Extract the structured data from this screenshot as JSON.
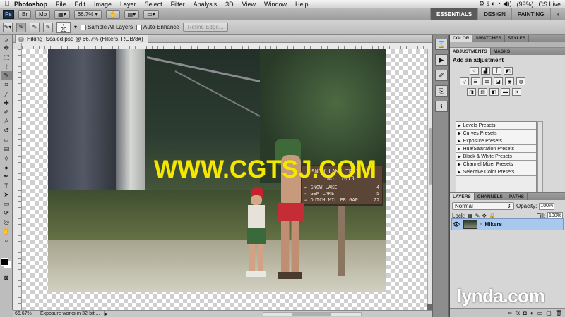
{
  "menubar": {
    "app": "Photoshop",
    "items": [
      "File",
      "Edit",
      "Image",
      "Layer",
      "Select",
      "Filter",
      "Analysis",
      "3D",
      "View",
      "Window",
      "Help"
    ],
    "battery": "(99%)",
    "cslive": "CS Live"
  },
  "appbar": {
    "ps": "Ps",
    "zoom": "66.7%",
    "workspaces": [
      "ESSENTIALS",
      "DESIGN",
      "PAINTING",
      "»"
    ]
  },
  "options": {
    "brush_size": "20",
    "sample_all": "Sample All Layers",
    "auto_enhance": "Auto-Enhance",
    "refine_edge": "Refine Edge..."
  },
  "document": {
    "tab_title": "Hiking_Scaled.psd @ 66.7% (Hikers, RGB/8#)",
    "sign": {
      "line1": "SNOW LAKE TRAIL",
      "line2": "NO. 1013",
      "rows": [
        {
          "label": "SNOW LAKE",
          "dist": "4"
        },
        {
          "label": "GEM LAKE",
          "dist": "5"
        },
        {
          "label": "DUTCH MILLER GAP",
          "dist": "22"
        }
      ]
    },
    "watermark": "WWW.CGTSJ.COM"
  },
  "status": {
    "zoom": "66.67%",
    "message": "Exposure works in 32-bit ..."
  },
  "panels": {
    "top_tabs": [
      "COLOR",
      "SWATCHES",
      "STYLES"
    ],
    "adj_tabs": [
      "ADJUSTMENTS",
      "MASKS"
    ],
    "adj_title": "Add an adjustment",
    "presets": [
      "Levels Presets",
      "Curves Presets",
      "Exposure Presets",
      "Hue/Saturation Presets",
      "Black & White Presets",
      "Channel Mixer Presets",
      "Selective Color Presets"
    ],
    "layer_tabs": [
      "LAYERS",
      "CHANNELS",
      "PATHS"
    ],
    "blend_mode": "Normal",
    "opacity_label": "Opacity:",
    "opacity": "100%",
    "lock_label": "Lock:",
    "fill_label": "Fill:",
    "fill": "100%",
    "layer_name": "Hikers"
  },
  "lynda": "lynda.com"
}
